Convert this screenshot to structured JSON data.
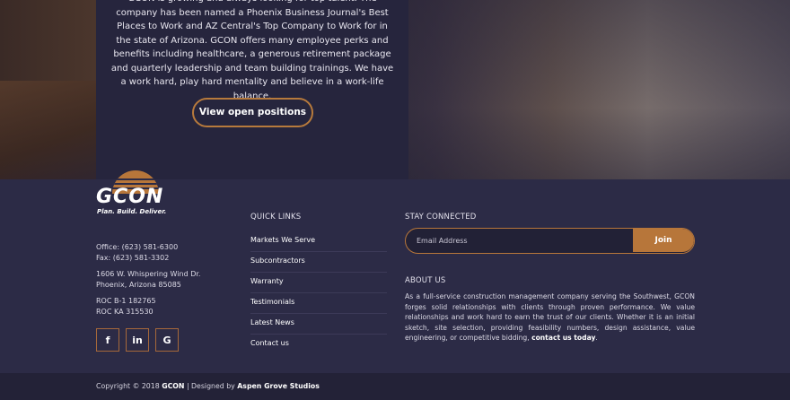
{
  "hero": {
    "text": "GCON is growing and always looking for top talent. The company has been named a Phoenix Business Journal's Best Places to Work and AZ Central's Top Company to Work for in the state of Arizona. GCON offers many employee perks and benefits including healthcare, a generous retirement package and quarterly leadership and team building trainings. We have a work hard, play hard mentality and believe in a work-life balance.",
    "button_label": "View open positions"
  },
  "brand": {
    "logo_text": "GCON",
    "tagline": "Plan. Build. Deliver.",
    "accent_color": "#b7763a",
    "background_color": "#2c2b46"
  },
  "contact": {
    "office": "Office: (623) 581-6300",
    "fax": "Fax: (623) 581-3302",
    "address_line1": "1606 W. Whispering Wind Dr.",
    "address_line2": "Phoenix, Arizona 85085",
    "roc1": "ROC B-1 182765",
    "roc2": "ROC KA 315530"
  },
  "social": [
    {
      "icon": "facebook-icon",
      "glyph": "f"
    },
    {
      "icon": "linkedin-icon",
      "glyph": "in"
    },
    {
      "icon": "glassdoor-icon",
      "glyph": "G"
    }
  ],
  "quick_links": {
    "title": "QUICK LINKS",
    "items": [
      "Markets We Serve",
      "Subcontractors",
      "Warranty",
      "Testimonials",
      "Latest News",
      "Contact us"
    ]
  },
  "stay_connected": {
    "title": "STAY CONNECTED",
    "email_placeholder": "Email Address",
    "join_label": "Join"
  },
  "about": {
    "title": "ABOUT US",
    "text": "As a full-service construction management company serving the Southwest, GCON forges solid relationships with clients through proven performance. We value relationships and work hard to earn the trust of our clients. Whether it is an initial sketch, site selection, providing feasibility numbers, design assistance, value engineering, or competitive bidding,",
    "link": "contact us today",
    "end": "."
  },
  "copyright": {
    "prefix": "Copyright © 2018",
    "company": "GCON",
    "middle": "| Designed by",
    "designer": "Aspen Grove Studios"
  }
}
